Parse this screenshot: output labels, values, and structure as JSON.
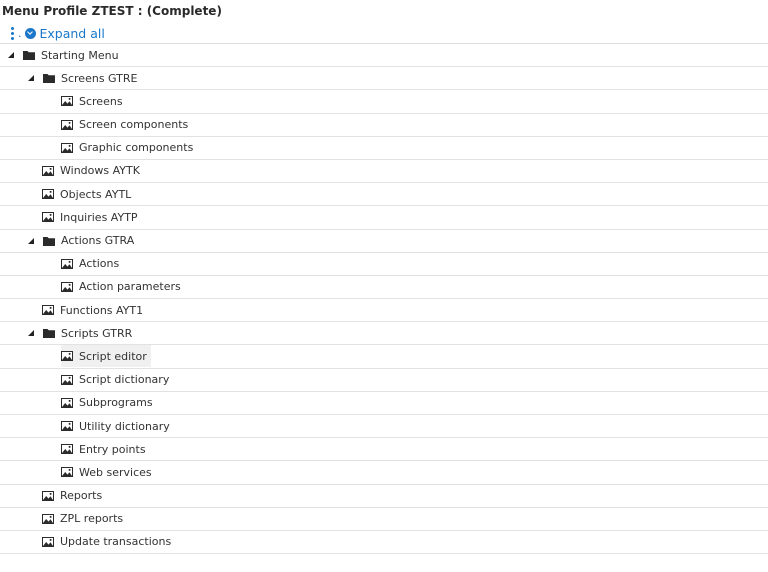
{
  "title": "Menu Profile ZTEST : (Complete)",
  "toolbar": {
    "menu_icon": "kebab-menu-icon",
    "separator": ".",
    "expand_icon": "expand-check-icon",
    "expand_label": "Expand all"
  },
  "colors": {
    "accent": "#1a77c9",
    "row_border": "#e2e2e2",
    "selected_bg": "#f0f0f0"
  },
  "tree": [
    {
      "label": "Starting Menu",
      "type": "folder",
      "level": 0,
      "expanded": true
    },
    {
      "label": "Screens GTRE",
      "type": "folder",
      "level": 1,
      "expanded": true
    },
    {
      "label": "Screens",
      "type": "leaf",
      "level": 2
    },
    {
      "label": "Screen components",
      "type": "leaf",
      "level": 2
    },
    {
      "label": "Graphic components",
      "type": "leaf",
      "level": 2
    },
    {
      "label": "Windows AYTK",
      "type": "leaf",
      "level": 1
    },
    {
      "label": "Objects AYTL",
      "type": "leaf",
      "level": 1
    },
    {
      "label": "Inquiries AYTP",
      "type": "leaf",
      "level": 1
    },
    {
      "label": "Actions GTRA",
      "type": "folder",
      "level": 1,
      "expanded": true
    },
    {
      "label": "Actions",
      "type": "leaf",
      "level": 2
    },
    {
      "label": "Action parameters",
      "type": "leaf",
      "level": 2
    },
    {
      "label": "Functions AYT1",
      "type": "leaf",
      "level": 1
    },
    {
      "label": "Scripts GTRR",
      "type": "folder",
      "level": 1,
      "expanded": true
    },
    {
      "label": "Script editor",
      "type": "leaf",
      "level": 2,
      "selected": true
    },
    {
      "label": "Script dictionary",
      "type": "leaf",
      "level": 2
    },
    {
      "label": "Subprograms",
      "type": "leaf",
      "level": 2
    },
    {
      "label": "Utility dictionary",
      "type": "leaf",
      "level": 2
    },
    {
      "label": "Entry points",
      "type": "leaf",
      "level": 2
    },
    {
      "label": "Web services",
      "type": "leaf",
      "level": 2
    },
    {
      "label": "Reports",
      "type": "leaf",
      "level": 1
    },
    {
      "label": "ZPL reports",
      "type": "leaf",
      "level": 1
    },
    {
      "label": "Update transactions",
      "type": "leaf",
      "level": 1
    }
  ]
}
